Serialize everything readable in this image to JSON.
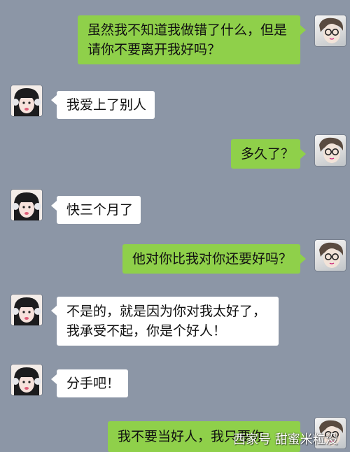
{
  "messages": [
    {
      "side": "me",
      "lines": [
        "虽然我不知道我做错了什么，但是",
        "请你不要离开我好吗？"
      ]
    },
    {
      "side": "her",
      "lines": [
        "我爱上了别人"
      ]
    },
    {
      "side": "me",
      "lines": [
        "多久了？"
      ]
    },
    {
      "side": "her",
      "lines": [
        "快三个月了"
      ]
    },
    {
      "side": "me",
      "lines": [
        "他对你比我对你还要好吗？"
      ]
    },
    {
      "side": "her",
      "lines": [
        "不是的，就是因为你对我太好了，",
        "我承受不起，你是个好人！"
      ]
    },
    {
      "side": "her",
      "lines": [
        "分手吧！"
      ]
    },
    {
      "side": "me",
      "lines": [
        "我不要当好人，我只要你"
      ]
    }
  ],
  "watermark": "西家号 甜蜜米粒没",
  "colors": {
    "background": "#8c96a6",
    "my_bubble": "#8fd04a",
    "her_bubble": "#ffffff"
  },
  "icons": {
    "me": "avatar-boy-with-glasses",
    "her": "avatar-girl-with-headphones"
  }
}
